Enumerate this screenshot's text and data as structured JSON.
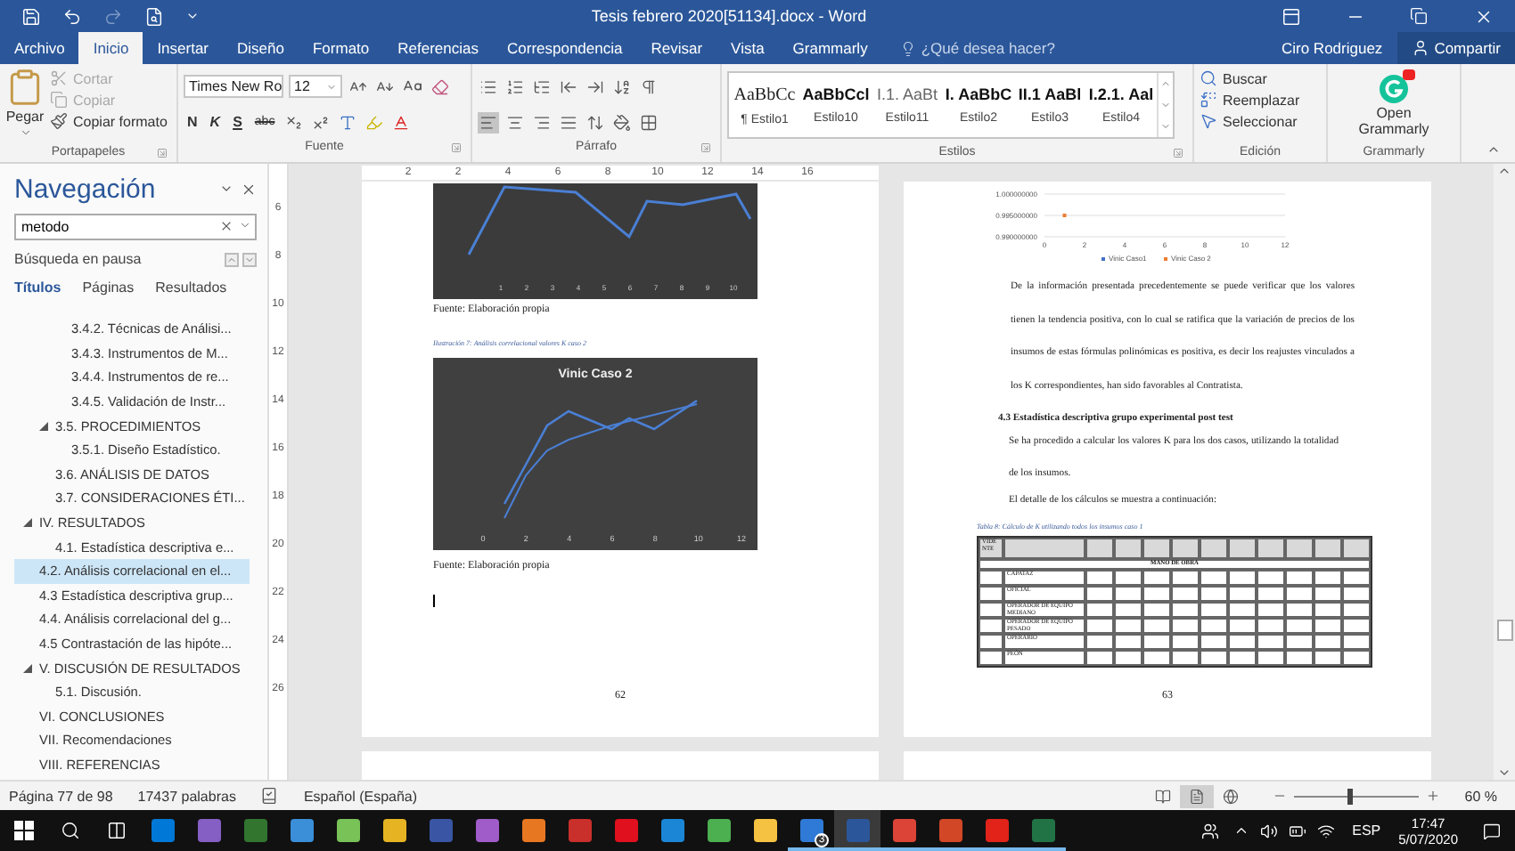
{
  "title_bar": {
    "title": "Tesis febrero 2020[51134].docx - Word"
  },
  "ribbon_tabs": [
    {
      "label": "Archivo",
      "selected": false
    },
    {
      "label": "Inicio",
      "selected": true
    },
    {
      "label": "Insertar",
      "selected": false
    },
    {
      "label": "Diseño",
      "selected": false
    },
    {
      "label": "Formato",
      "selected": false
    },
    {
      "label": "Referencias",
      "selected": false
    },
    {
      "label": "Correspondencia",
      "selected": false
    },
    {
      "label": "Revisar",
      "selected": false
    },
    {
      "label": "Vista",
      "selected": false
    },
    {
      "label": "Grammarly",
      "selected": false
    }
  ],
  "tell_me": {
    "placeholder": "¿Qué desea hacer?"
  },
  "user": "Ciro Rodriguez",
  "share": "Compartir",
  "clipboard": {
    "label": "Portapapeles",
    "paste": "Pegar",
    "items": [
      {
        "kind": "cut",
        "label": "Cortar",
        "disabled": true
      },
      {
        "kind": "copy",
        "label": "Copiar",
        "disabled": true
      },
      {
        "kind": "format",
        "label": "Copiar formato",
        "disabled": false
      }
    ]
  },
  "font": {
    "label": "Fuente",
    "name": "Times New Ro",
    "size": "12",
    "styles": [
      "N",
      "K",
      "S",
      "abc"
    ]
  },
  "paragraph": {
    "label": "Párrafo",
    "align_buttons": [
      {
        "kind": "left",
        "selected": true
      },
      {
        "kind": "center",
        "selected": false
      },
      {
        "kind": "right",
        "selected": false
      },
      {
        "kind": "justify",
        "selected": false
      }
    ]
  },
  "styles": {
    "label": "Estilos",
    "items": [
      {
        "preview": "AaBbCc",
        "name": "¶ Estilo1",
        "kind": "normal"
      },
      {
        "preview": "AaBbCcl",
        "name": "Estilo10",
        "kind": "bold"
      },
      {
        "preview": "I.1. AaBt",
        "name": "Estilo11",
        "kind": "light"
      },
      {
        "preview": "I. AaBbC",
        "name": "Estilo2",
        "kind": "bold"
      },
      {
        "preview": "II.1 AaBl",
        "name": "Estilo3",
        "kind": "bold"
      },
      {
        "preview": "I.2.1. Aal",
        "name": "Estilo4",
        "kind": "bold"
      }
    ]
  },
  "editing": {
    "label": "Edición",
    "items": [
      {
        "kind": "find",
        "label": "Buscar"
      },
      {
        "kind": "replace",
        "label": "Reemplazar"
      },
      {
        "kind": "select",
        "label": "Seleccionar"
      }
    ]
  },
  "grammarly": {
    "label": "Grammarly",
    "button": "Open Grammarly"
  },
  "navigation": {
    "title": "Navegación",
    "search": "metodo",
    "status": "Búsqueda en pausa",
    "tabs": [
      {
        "label": "Títulos",
        "selected": true
      },
      {
        "label": "Páginas",
        "selected": false
      },
      {
        "label": "Resultados",
        "selected": false
      }
    ],
    "headings": [
      {
        "children": [
          {
            "children": [
              {
                "label": "3.4.2. Técnicas de Análisi...",
                "selected": false
              },
              {
                "label": "3.4.3. Instrumentos de M...",
                "selected": false
              },
              {
                "label": "3.4.4. Instrumentos de re...",
                "selected": false
              },
              {
                "label": "3.4.5. Validación de Instr...",
                "selected": false
              }
            ]
          },
          {
            "label": "3.5. PROCEDIMIENTOS",
            "selected": false,
            "expanded": true,
            "children": [
              {
                "label": "3.5.1. Diseño Estadístico.",
                "selected": false
              }
            ]
          },
          {
            "label": "3.6. ANÁLISIS DE DATOS",
            "selected": false
          },
          {
            "label": "3.7. CONSIDERACIONES ÉTI...",
            "selected": false
          }
        ]
      },
      {
        "label": "IV. RESULTADOS",
        "selected": false,
        "expanded": true,
        "children": [
          {
            "label": "4.1. Estadística descriptiva e...",
            "selected": false
          }
        ]
      },
      {
        "label": "4.2. Análisis correlacional en el...",
        "selected": true
      },
      {
        "label": "4.3 Estadística descriptiva grup...",
        "selected": false
      },
      {
        "label": "4.4. Análisis correlacional del g...",
        "selected": false
      },
      {
        "label": "4.5 Contrastación de las hipóte...",
        "selected": false
      },
      {
        "label": "V. DISCUSIÓN DE RESULTADOS",
        "selected": false,
        "expanded": true,
        "children": [
          {
            "label": "5.1. Discusión.",
            "selected": false
          }
        ]
      },
      {
        "label": "VI. CONCLUSIONES",
        "selected": false
      },
      {
        "label": "VII. Recomendaciones",
        "selected": false
      },
      {
        "label": "VIII. REFERENCIAS",
        "selected": false
      }
    ]
  },
  "ruler": {
    "marks": [
      "2",
      "2",
      "4",
      "6",
      "8",
      "10",
      "12",
      "14",
      "16"
    ]
  },
  "vertical_ruler": {
    "marks": [
      "6",
      "8",
      "10",
      "12",
      "14",
      "16",
      "18",
      "20",
      "22",
      "24",
      "26"
    ]
  },
  "left_page": {
    "chart_1": {
      "x_labels": [
        "1",
        "2",
        "3",
        "4",
        "5",
        "6",
        "7",
        "8",
        "9",
        "10"
      ]
    },
    "source_1": "Fuente: Elaboración propia",
    "caption": "Ilustración 7: Análisis correlacional valores K caso 2",
    "chart_2": {
      "title": "Vinic Caso 2",
      "x_labels": [
        "0",
        "2",
        "4",
        "6",
        "8",
        "10",
        "12"
      ]
    },
    "source_2": "Fuente: Elaboración propia",
    "page_number": "62"
  },
  "right_page": {
    "chart_data": {
      "type": "scatter",
      "x": [
        1
      ],
      "series": [
        {
          "name": "Vinic Caso1",
          "color": "#4472c4",
          "values": [
            null
          ]
        },
        {
          "name": "Vinic Caso 2",
          "color": "#ed7d31",
          "values": [
            0.995
          ]
        }
      ],
      "xlim": [
        0,
        12
      ],
      "ylim": [
        0.99,
        1.0
      ],
      "xticks": [
        0,
        2,
        4,
        6,
        8,
        10,
        12
      ],
      "yticks": [
        {
          "value": 0.99,
          "label": "0.990000000"
        },
        {
          "value": 0.995,
          "label": "0.995000000"
        },
        {
          "value": 1.0,
          "label": "1.000000000"
        }
      ]
    },
    "paragraph_1": "De la información presentada precedentemente se puede verificar que los valores tienen la tendencia positiva, con lo cual se ratifica que la variación de precios de los insumos de estas fórmulas polinómicas es positiva, es decir los reajustes vinculados a los K correspondientes, han sido favorables al Contratista.",
    "heading": "4.3 Estadística descriptiva grupo experimental post test",
    "paragraph_2": "Se ha procedido a calcular los valores K para los dos casos, utilizando la totalidad de los insumos.",
    "paragraph_3": "El detalle de los cálculos se muestra a continuación:",
    "table_caption": "Tabla 8: Cálculo de K utilizando todos los insumos caso 1",
    "table": {
      "header": "VIDE NTE",
      "category": "MANO DE OBRA",
      "rows": [
        "CAPATAZ",
        "OFICIAL",
        "OPERADOR DE EQUIPO MEDIANO",
        "OPERADOR DE EQUIPO PESADO",
        "OPERARIO",
        "PEÓN"
      ]
    },
    "page_number": "63"
  },
  "status_bar": {
    "page": "Página 77 de 98",
    "words": "17437 palabras",
    "language": "Español (España)",
    "views": [
      {
        "kind": "read",
        "selected": false
      },
      {
        "kind": "print",
        "selected": true
      },
      {
        "kind": "web",
        "selected": false
      }
    ],
    "zoom": {
      "level": 0.45,
      "reading": "60 %"
    }
  },
  "taskbar": {
    "apps": [
      {
        "color": "#0078d7",
        "running": false,
        "active": false
      },
      {
        "color": "#865fc5",
        "running": false,
        "active": false
      },
      {
        "color": "#31752f",
        "running": false,
        "active": false
      },
      {
        "color": "#3a8fd8",
        "running": false,
        "active": false
      },
      {
        "color": "#78c257",
        "running": false,
        "active": false
      },
      {
        "color": "#e6b422",
        "running": false,
        "active": false
      },
      {
        "color": "#3955a3",
        "running": false,
        "active": false
      },
      {
        "color": "#a05cc8",
        "running": false,
        "active": false
      },
      {
        "color": "#e87722",
        "running": false,
        "active": false
      },
      {
        "color": "#c9302c",
        "running": false,
        "active": false
      },
      {
        "color": "#e0101e",
        "running": false,
        "active": false
      },
      {
        "color": "#1b86d6",
        "running": false,
        "active": false
      },
      {
        "color": "#4caf50",
        "running": false,
        "active": false
      },
      {
        "color": "#f5c242",
        "running": false,
        "active": false
      },
      {
        "color": "#2f7ad6",
        "running": true,
        "active": false,
        "badge": "3"
      },
      {
        "color": "#2b579a",
        "running": true,
        "active": true
      },
      {
        "color": "#db4437",
        "running": true,
        "active": false
      },
      {
        "color": "#d24726",
        "running": true,
        "active": false
      },
      {
        "color": "#e2231a",
        "running": true,
        "active": false
      },
      {
        "color": "#217346",
        "running": true,
        "active": false
      }
    ],
    "language": "ESP",
    "time": "17:47",
    "date": "5/07/2020"
  }
}
